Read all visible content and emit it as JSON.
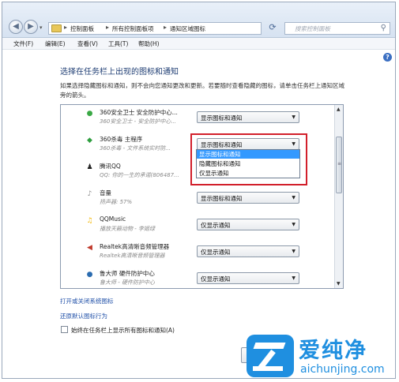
{
  "address_bar": {
    "crumbs": [
      "控制面板",
      "所有控制面板项",
      "通知区域图标"
    ],
    "search_placeholder": "搜索控制面板"
  },
  "menu": [
    "文件(F)",
    "编辑(E)",
    "查看(V)",
    "工具(T)",
    "帮助(H)"
  ],
  "page": {
    "title": "选择在任务栏上出现的图标和通知",
    "description": "如果选择隐藏图标和通知，则不会向您通知更改和更新。若要随时查看隐藏的图标，请单击任务栏上通知区域旁的箭头。"
  },
  "icon_rows": [
    {
      "name": "360安全卫士 安全防护中心...",
      "sub": "360安全卫士 - 安全防护中心...",
      "behavior": "显示图标和通知",
      "icon": "shield-icon",
      "color": "#3aa845"
    },
    {
      "name": "360杀毒 主程序",
      "sub": "360杀毒 - 文件系统实时防...",
      "behavior": "显示图标和通知",
      "icon": "antivirus-icon",
      "color": "#2e9e3e"
    },
    {
      "name": "腾讯QQ",
      "sub": "QQ: 你的一生的承诺(806487...",
      "behavior": "",
      "icon": "qq-penguin-icon",
      "color": "#222222"
    },
    {
      "name": "音量",
      "sub": "扬声器: 57%",
      "behavior": "显示图标和通知",
      "icon": "speaker-icon",
      "color": "#8a8a8a"
    },
    {
      "name": "QQMusic",
      "sub": "播放天籁动物 - 李姬绿",
      "behavior": "仅显示通知",
      "icon": "music-icon",
      "color": "#f2b705"
    },
    {
      "name": "Realtek高清晰音频管理器",
      "sub": "Realtek高清晰音频管理器",
      "behavior": "仅显示通知",
      "icon": "realtek-speaker-icon",
      "color": "#c0392b"
    },
    {
      "name": "鲁大师 硬件防护中心",
      "sub": "鲁大师 - 硬件防护中心",
      "behavior": "仅显示通知",
      "icon": "ludashi-icon",
      "color": "#2b6cb0"
    }
  ],
  "dropdown_options": [
    "显示图标和通知",
    "隐藏图标和通知",
    "仅显示通知"
  ],
  "links": {
    "toggle_system_icons": "打开或关闭系统图标",
    "restore_default": "还原默认图标行为"
  },
  "always_show_label": "始终在任务栏上显示所有图标和通知(A)",
  "watermark": {
    "brand": "爱纯净",
    "url": "aichunjing.com"
  }
}
